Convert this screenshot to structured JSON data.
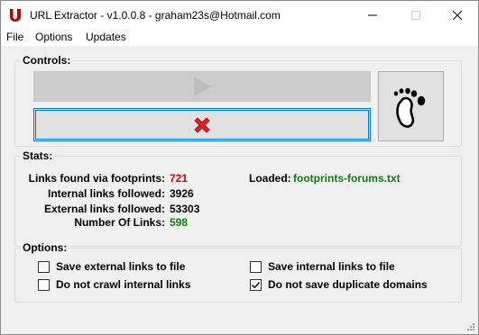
{
  "window": {
    "title": "URL Extractor - v1.0.0.8 - graham23s@Hotmail.com"
  },
  "menu": [
    "File",
    "Options",
    "Updates"
  ],
  "controls": {
    "group_label": "Controls:",
    "play_icon": "play-icon",
    "stop_icon": "red-x-icon",
    "footprint_icon": "footprints-icon"
  },
  "stats": {
    "group_label": "Stats:",
    "links_found_label": "Links found via footprints:",
    "links_found_value": "721",
    "internal_label": "Internal links followed:",
    "internal_value": "3926",
    "external_label": "External links followed:",
    "external_value": "53303",
    "number_label": "Number Of Links:",
    "number_value": "598",
    "loaded_label": "Loaded:",
    "loaded_value": "footprints-forums.txt",
    "colors": {
      "red": "#e00000",
      "green": "#107c10"
    }
  },
  "options": {
    "group_label": "Options:",
    "save_external": {
      "label": "Save external links to file",
      "checked": false
    },
    "save_internal": {
      "label": "Save internal links to file",
      "checked": false
    },
    "no_crawl_internal": {
      "label": "Do not crawl internal links",
      "checked": false
    },
    "no_duplicate_domains": {
      "label": "Do not save duplicate domains",
      "checked": true
    }
  }
}
